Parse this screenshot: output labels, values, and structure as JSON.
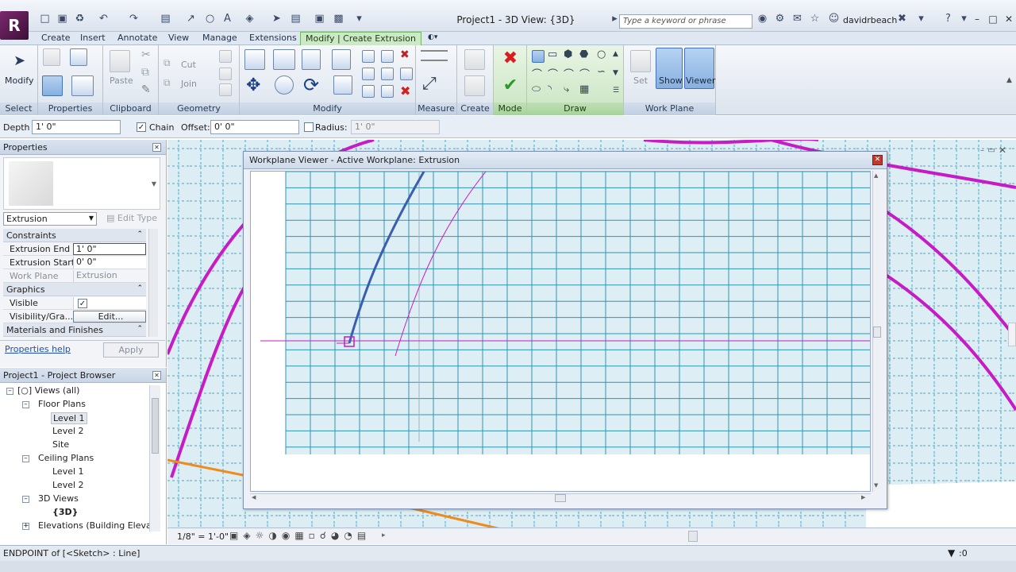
{
  "titlebar": {
    "app_logo": "R",
    "doc_title": "Project1 - 3D View: {3D}",
    "search_placeholder": "Type a keyword or phrase",
    "user_name": "davidrbeach",
    "help": "?"
  },
  "ribbon_tabs": [
    {
      "label": "Create"
    },
    {
      "label": "Insert"
    },
    {
      "label": "Annotate"
    },
    {
      "label": "View"
    },
    {
      "label": "Manage"
    },
    {
      "label": "Extensions"
    },
    {
      "label": "Modify | Create Extrusion",
      "active": true
    }
  ],
  "ribbon": {
    "select": {
      "panel": "Select",
      "modify_label": "Modify"
    },
    "properties": {
      "panel": "Properties"
    },
    "clipboard": {
      "panel": "Clipboard",
      "paste_label": "Paste"
    },
    "geometry": {
      "panel": "Geometry",
      "cut_label": "Cut",
      "join_label": "Join"
    },
    "modify": {
      "panel": "Modify"
    },
    "measure": {
      "panel": "Measure"
    },
    "create": {
      "panel": "Create"
    },
    "mode": {
      "panel": "Mode"
    },
    "draw": {
      "panel": "Draw"
    },
    "workplane": {
      "panel": "Work Plane",
      "set_label": "Set",
      "show_label": "Show",
      "viewer_label": "Viewer"
    }
  },
  "options_bar": {
    "depth_label": "Depth",
    "depth_value": "1'  0\"",
    "chain_label": "Chain",
    "chain_checked": true,
    "offset_label": "Offset:",
    "offset_value": "0'  0\"",
    "radius_label": "Radius:",
    "radius_checked": false,
    "radius_value": "1'  0\""
  },
  "properties": {
    "title": "Properties",
    "type_selector": "Extrusion",
    "edit_type": "Edit Type",
    "groups": [
      {
        "name": "Constraints"
      },
      {
        "name": "Graphics"
      },
      {
        "name": "Materials and Finishes"
      }
    ],
    "rows": [
      {
        "name": "Extrusion End",
        "value": "1'  0\""
      },
      {
        "name": "Extrusion Start",
        "value": "0'  0\""
      },
      {
        "name": "Work Plane",
        "value": "Extrusion"
      },
      {
        "name": "Visible",
        "value": "✓"
      },
      {
        "name": "Visibility/Gra...",
        "value": "Edit..."
      }
    ],
    "help_link": "Properties help",
    "apply": "Apply"
  },
  "browser": {
    "title": "Project1 - Project Browser",
    "items": [
      {
        "label": "Views (all)"
      },
      {
        "label": "Floor Plans"
      },
      {
        "label": "Level 1"
      },
      {
        "label": "Level 2"
      },
      {
        "label": "Site"
      },
      {
        "label": "Ceiling Plans"
      },
      {
        "label": "Level 1"
      },
      {
        "label": "Level 2"
      },
      {
        "label": "3D Views"
      },
      {
        "label": "{3D}"
      },
      {
        "label": "Elevations (Building Elevatio"
      }
    ]
  },
  "workplane_viewer": {
    "title": "Workplane Viewer - Active Workplane: Extrusion"
  },
  "view_bar": {
    "scale": "1/8\" = 1'-0\""
  },
  "statusbar": {
    "message": "ENDPOINT  of [<Sketch> : Line]",
    "filter_count": ":0"
  },
  "colors": {
    "sketch_magenta": "#c61cc6",
    "model_line_blue": "#3a5fb0",
    "grid_teal": "#2f95b3",
    "ref_orange": "#f08a1c",
    "active_tab_green": "#cde8c7"
  }
}
